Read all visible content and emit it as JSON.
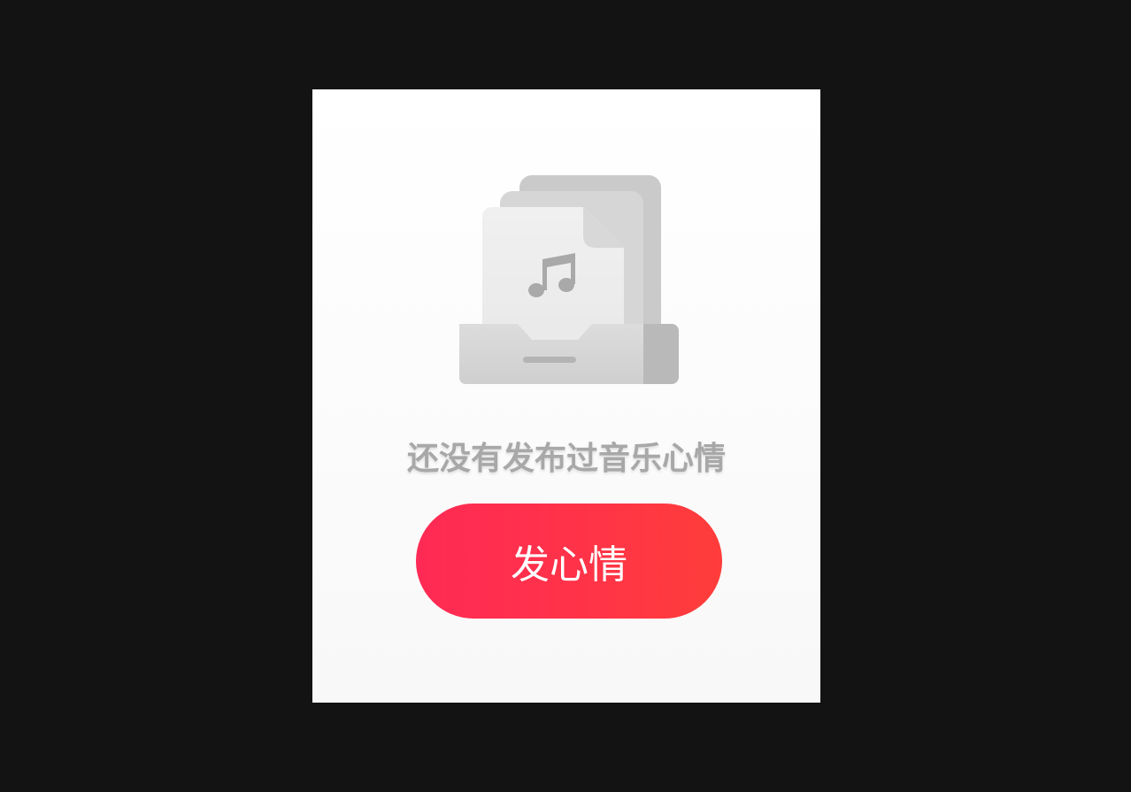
{
  "empty_state": {
    "icon": "music-file-inbox-icon",
    "message": "还没有发布过音乐心情",
    "button_label": "发心情"
  },
  "colors": {
    "page_background": "#131313",
    "panel_background": "#f8f8f8",
    "message_text": "#a8a8a8",
    "button_gradient_start": "#ff2a55",
    "button_gradient_end": "#ff3d3a",
    "button_text": "#ffffff"
  }
}
